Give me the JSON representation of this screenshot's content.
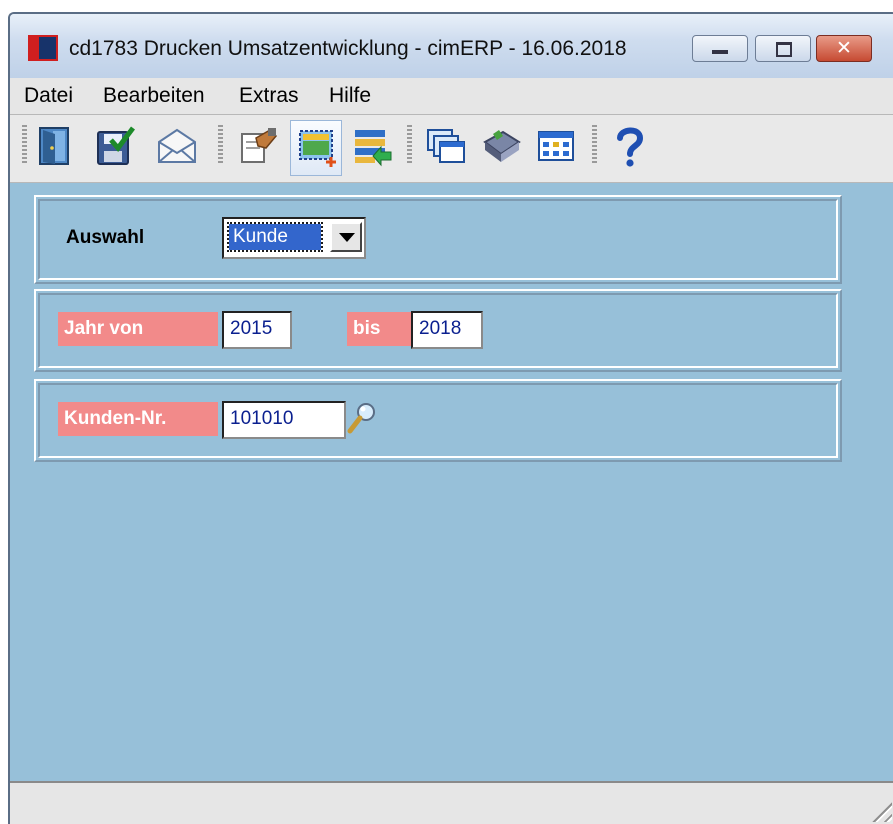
{
  "window": {
    "title": "cd1783 Drucken Umsatzentwicklung - cimERP - 16.06.2018",
    "controls": {
      "minimize": "minimize",
      "maximize": "maximize",
      "close": "close"
    }
  },
  "menu": {
    "items": [
      "Datei",
      "Bearbeiten",
      "Extras",
      "Hilfe"
    ]
  },
  "toolbar": {
    "buttons": [
      {
        "icon": "exit-door-icon"
      },
      {
        "icon": "save-check-icon"
      },
      {
        "icon": "mail-envelope-icon"
      },
      {
        "icon": "edit-hand-icon"
      },
      {
        "icon": "new-selection-icon"
      },
      {
        "icon": "list-import-icon"
      },
      {
        "icon": "window-stack-icon"
      },
      {
        "icon": "book-icon"
      },
      {
        "icon": "calendar-grid-icon"
      },
      {
        "icon": "help-question-icon"
      }
    ]
  },
  "form": {
    "auswahl": {
      "label": "Auswahl",
      "value": "Kunde"
    },
    "jahr": {
      "label_from": "Jahr von",
      "value_from": "2015",
      "label_to": "bis",
      "value_to": "2018"
    },
    "kunde": {
      "label": "Kunden-Nr.",
      "value": "101010",
      "lookup_icon": "magnifier-icon"
    }
  },
  "status": {
    "text": ""
  },
  "colors": {
    "client_background": "#97c0d9",
    "label_background": "#f28a8a",
    "value_text": "#0a1f8f"
  }
}
